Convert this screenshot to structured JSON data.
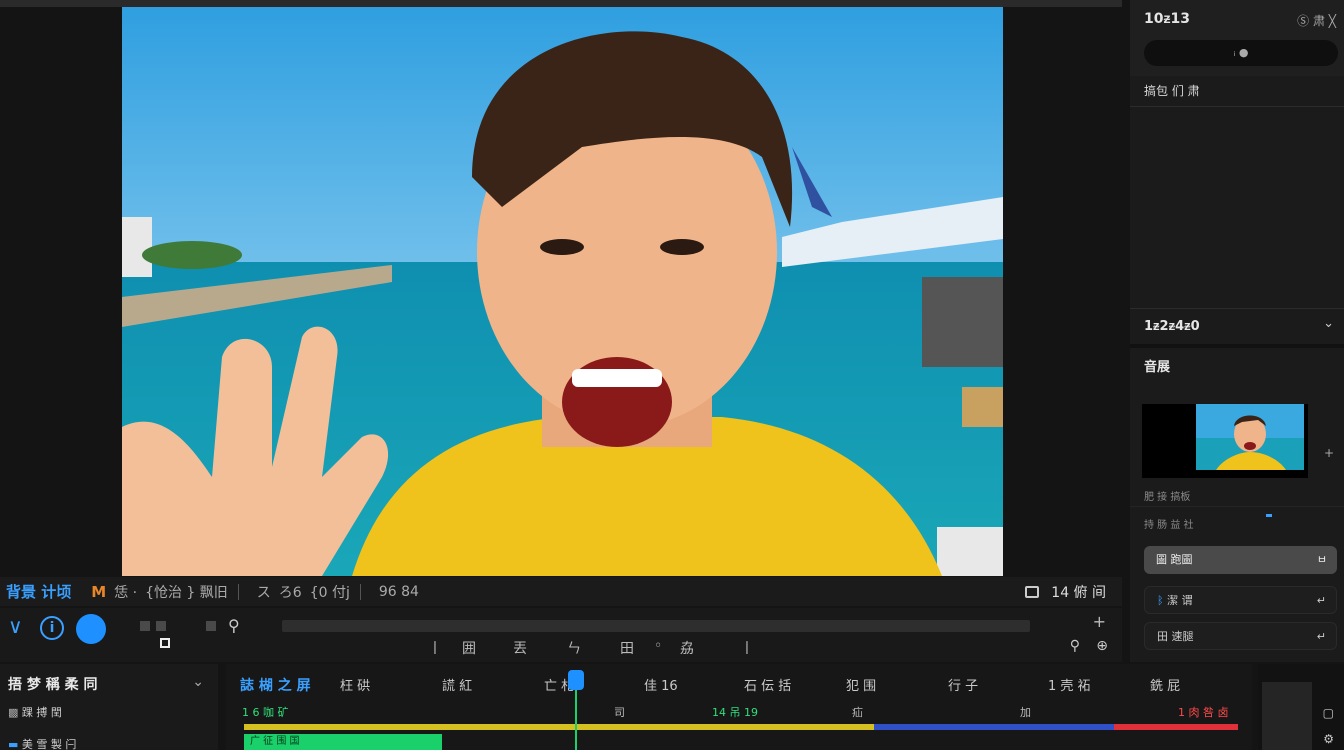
{
  "preview": {
    "image_description_icon": "video-preview-frame"
  },
  "infobar": {
    "project_title": "背景 计顷",
    "fx_label": "M",
    "t1": "恁 ·",
    "t2": "{怆治 } 飘旧",
    "t3": "ス",
    "t4": "ろ6",
    "t5": "{0 付j",
    "t6": "l",
    "t7": "96 84",
    "zoom": "14 俯 间"
  },
  "playback": {
    "tools": [
      "丨",
      "囲",
      "丟",
      "ㄣ",
      "田",
      "◦",
      "劦",
      "丨"
    ]
  },
  "right_panel": {
    "title": "10ᵶ13",
    "icons": "Ⓢ 肃 ╳",
    "search_text": "ᵢ ●",
    "sub_title": "搞包 们 肃",
    "sec1": "1ᵶ2ᵶ4ᵶ0",
    "sec2": "音展",
    "label1": "肥 接 搞板",
    "label2": "持 肠 益 社",
    "btn1": "圖 跑圖",
    "btn1_arrow": "ㅂ",
    "btn2": "潔 谓",
    "btn2_arrow": "↵",
    "btn3": "田 速腿",
    "btn3_arrow": "↵"
  },
  "timeline": {
    "left_title": "捂 梦 稱 柔 同",
    "row1": "踝 搏 閏",
    "row2": "美 雪 製 闩",
    "tabs": [
      "誌 楜 之 屏",
      "枉 硔",
      "謊 紅",
      "亡 札",
      "佳 16",
      "石 伝 括",
      "犯 围",
      "行 子",
      "1 壳 祏",
      "銑 屁"
    ],
    "ruler": [
      "1 6 咖 矿",
      "司",
      "14 吊 19",
      "疝",
      "加",
      "1 肉 咎 卤"
    ],
    "clip_label": "广 征 围 国"
  },
  "colors": {
    "accent": "#1e90ff",
    "accent_text": "#3aa0ff",
    "green": "#19d06a",
    "orange": "#e8862a",
    "track_yellow": "#d4c020",
    "track_blue": "#3050c8",
    "track_red": "#e0303a"
  }
}
